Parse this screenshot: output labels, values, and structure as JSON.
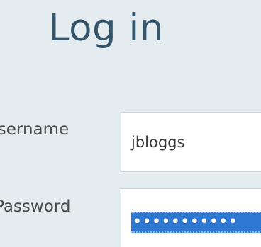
{
  "login": {
    "title": "Log in",
    "username_label": "Isername",
    "username_value": "jbloggs",
    "password_label": "Password",
    "password_value": "•••••••••••"
  },
  "colors": {
    "background": "#e4ecef",
    "title": "#34556a",
    "selection": "#2f78d2"
  }
}
